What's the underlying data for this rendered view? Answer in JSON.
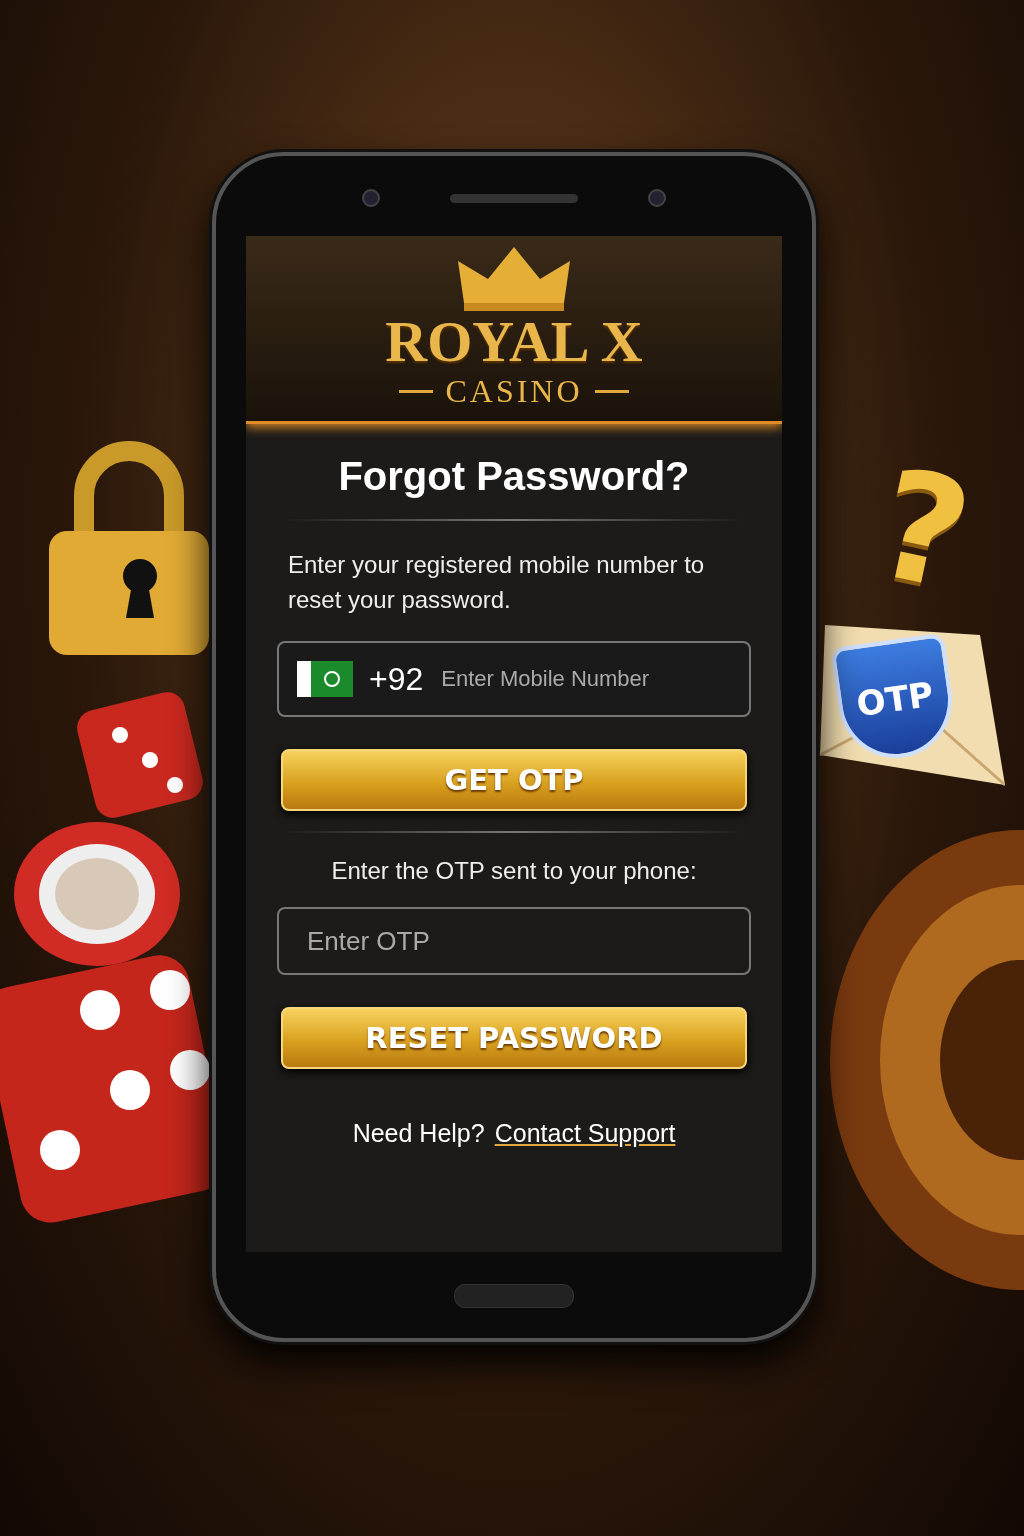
{
  "brand": {
    "name": "ROYAL X",
    "subtitle": "CASINO"
  },
  "title": "Forgot Password?",
  "instructions": "Enter your registered mobile number to reset your password.",
  "phone_field": {
    "country_code": "+92",
    "placeholder": "Enter Mobile Number"
  },
  "get_otp_button": "GET OTP",
  "otp_prompt": "Enter the OTP sent to your phone:",
  "otp_field": {
    "placeholder": "Enter OTP"
  },
  "reset_button": "RESET PASSWORD",
  "help": {
    "text": "Need Help?",
    "link": "Contact Support"
  },
  "decorations": {
    "otp_badge": "OTP",
    "question_mark": "?"
  }
}
